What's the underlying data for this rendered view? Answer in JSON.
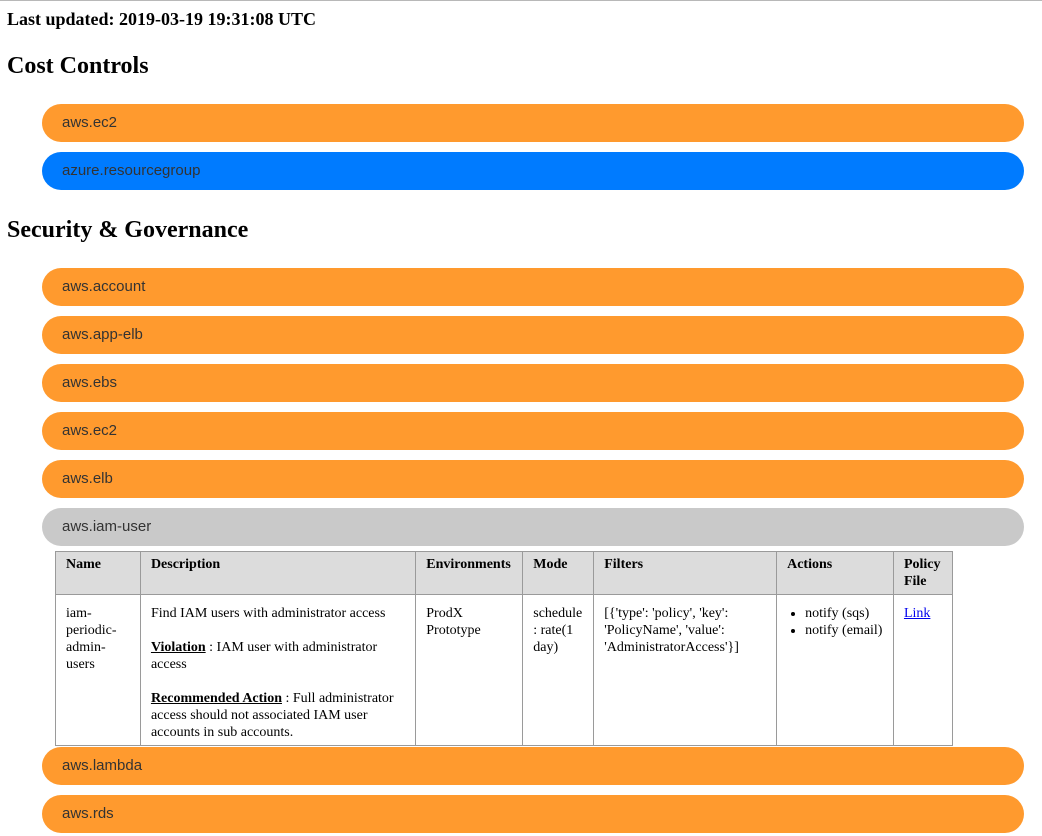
{
  "header": {
    "last_updated": "Last updated: 2019-03-19 19:31:08 UTC"
  },
  "colors": {
    "aws_orange": "#ff9a2e",
    "azure_blue": "#007bff",
    "expanded_gray": "#c9c9c9"
  },
  "sections": [
    {
      "title": "Cost Controls",
      "items": [
        {
          "label": "aws.ec2",
          "state": "collapsed"
        },
        {
          "label": "azure.resourcegroup",
          "state": "collapsed"
        }
      ]
    },
    {
      "title": "Security & Governance",
      "items": [
        {
          "label": "aws.account",
          "state": "collapsed"
        },
        {
          "label": "aws.app-elb",
          "state": "collapsed"
        },
        {
          "label": "aws.ebs",
          "state": "collapsed"
        },
        {
          "label": "aws.ec2",
          "state": "collapsed"
        },
        {
          "label": "aws.elb",
          "state": "collapsed"
        },
        {
          "label": "aws.iam-user",
          "state": "expanded"
        },
        {
          "label": "aws.lambda",
          "state": "collapsed"
        },
        {
          "label": "aws.rds",
          "state": "collapsed"
        }
      ]
    }
  ],
  "policy_table": {
    "headers": [
      "Name",
      "Description",
      "Environments",
      "Mode",
      "Filters",
      "Actions",
      "Policy File"
    ],
    "row": {
      "name": "iam-periodic-admin-users",
      "description": "Find IAM users with administrator access",
      "violation_label": "Violation",
      "violation_text": " : IAM user with administrator access",
      "recommended_label": "Recommended Action",
      "recommended_text": " : Full administrator access should not associated IAM user accounts in sub accounts.",
      "environments": "ProdX Prototype",
      "mode": "schedule : rate(1 day)",
      "filters": "[{'type': 'policy', 'key': 'PolicyName', 'value': 'AdministratorAccess'}]",
      "actions": [
        "notify (sqs)",
        "notify (email)"
      ],
      "policy_file": "Link"
    }
  }
}
